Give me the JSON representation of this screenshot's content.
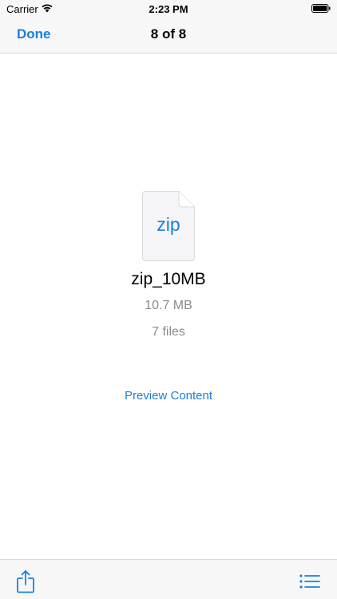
{
  "status_bar": {
    "carrier": "Carrier",
    "time": "2:23 PM",
    "wifi_icon": "wifi-icon",
    "battery_icon": "battery-icon"
  },
  "nav": {
    "done_label": "Done",
    "title": "8 of 8"
  },
  "file": {
    "icon": "zip-file-icon",
    "extension": "zip",
    "name": "zip_10MB",
    "size": "10.7 MB",
    "count": "7 files"
  },
  "actions": {
    "preview_label": "Preview Content"
  },
  "toolbar": {
    "share_icon": "share-icon",
    "list_icon": "list-icon"
  },
  "colors": {
    "accent": "#1b7fdc",
    "secondary_text": "#8a8a8e",
    "bar_background": "#f7f7f7"
  }
}
